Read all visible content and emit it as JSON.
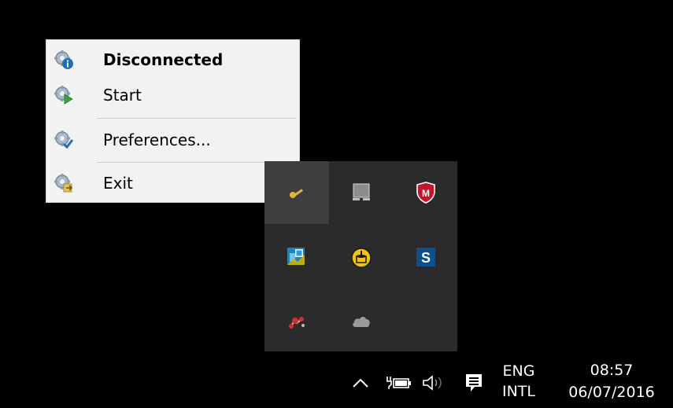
{
  "context_menu": {
    "items": [
      {
        "label": "Disconnected",
        "icon": "gear-info-icon",
        "bold": true
      },
      {
        "label": "Start",
        "icon": "gear-play-icon",
        "bold": false
      },
      {
        "label": "Preferences...",
        "icon": "gear-check-icon",
        "bold": false
      },
      {
        "label": "Exit",
        "icon": "gear-exit-icon",
        "bold": false
      }
    ]
  },
  "tray_overflow": {
    "icons": [
      {
        "name": "key-icon",
        "hovered": true
      },
      {
        "name": "display-icon"
      },
      {
        "name": "mcafee-shield-icon",
        "label": "M"
      },
      {
        "name": "excel-addin-icon"
      },
      {
        "name": "cake-icon"
      },
      {
        "name": "s-app-icon",
        "label": "S"
      },
      {
        "name": "figure-app-icon"
      },
      {
        "name": "cloud-icon"
      }
    ]
  },
  "taskbar": {
    "chevron_icon": "chevron-up-icon",
    "power_icon": "battery-plug-icon",
    "volume_icon": "speaker-icon",
    "notifications_icon": "action-center-icon",
    "language": {
      "line1": "ENG",
      "line2": "INTL"
    },
    "clock": {
      "time": "08:57",
      "date": "06/07/2016"
    }
  },
  "colors": {
    "desktop": "#000000",
    "menu_bg": "#f2f2f2",
    "tray_bg": "#2b2b2b",
    "tray_hover": "#3e3e3e",
    "mcafee_red": "#c0182a",
    "accent_blue": "#1f6fb8"
  }
}
